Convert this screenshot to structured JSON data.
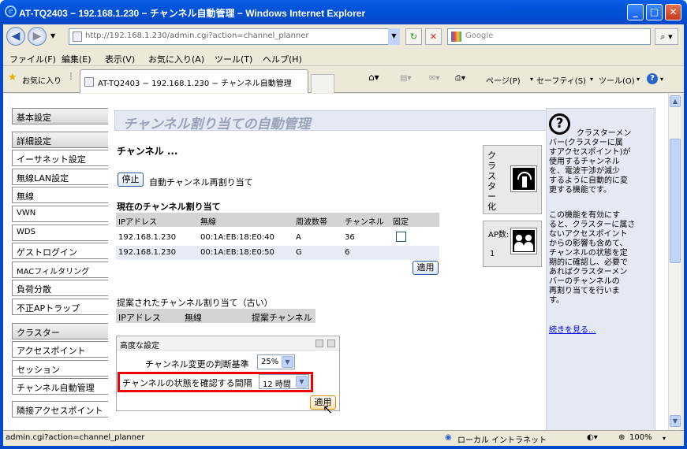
{
  "window": {
    "title": "AT-TQ2403 − 192.168.1.230 − チャンネル自動管理 − Windows Internet Explorer"
  },
  "addressbar": {
    "url": "http://192.168.1.230/admin.cgi?action=channel_planner",
    "search_placeholder": "Google"
  },
  "menu": [
    "ファイル(F)",
    "編集(E)",
    "表示(V)",
    "お気に入り(A)",
    "ツール(T)",
    "ヘルプ(H)"
  ],
  "tabbar": {
    "favorites": "お気に入り",
    "tab_title": "AT-TQ2403 − 192.168.1.230 − チャンネル自動管理",
    "page": "ページ(P)",
    "safety": "セーフティ(S)",
    "tools": "ツール(O)"
  },
  "sidebar": [
    {
      "label": "基本設定"
    },
    {
      "label": "詳細設定"
    },
    {
      "label": "イーサネット設定"
    },
    {
      "label": "無線LAN設定"
    },
    {
      "label": "無線"
    },
    {
      "label": "VWN"
    },
    {
      "label": "WDS"
    },
    {
      "label": "ゲストログイン"
    },
    {
      "label": "MACフィルタリング"
    },
    {
      "label": "負荷分散"
    },
    {
      "label": "不正APトラップ"
    },
    {
      "label": "クラスター"
    },
    {
      "label": "アクセスポイント"
    },
    {
      "label": "セッション"
    },
    {
      "label": "チャンネル自動管理"
    },
    {
      "label": "隣接アクセスポイント"
    }
  ],
  "main": {
    "page_title": "チャンネル割り当ての自動管理",
    "section_title": "チャンネル ...",
    "stop_button": "停止",
    "auto_label": "自動チャンネル再割り当て",
    "current_title": "現在のチャンネル割り当て",
    "current_headers": [
      "IPアドレス",
      "無線",
      "周波数帯",
      "チャンネル",
      "固定"
    ],
    "current_rows": [
      {
        "ip": "192.168.1.230",
        "radio": "00:1A:EB:18:E0:40",
        "band": "A",
        "channel": "36"
      },
      {
        "ip": "192.168.1.230",
        "radio": "00:1A:EB:18:E0:50",
        "band": "G",
        "channel": "6"
      }
    ],
    "apply_label": "適用",
    "proposed_title": "提案されたチャンネル割り当て（古い）",
    "proposed_headers": [
      "IPアドレス",
      "無線",
      "提案チャンネル"
    ],
    "advanced": {
      "title": "高度な設定",
      "criterion_label": "チャンネル変更の判断基準",
      "criterion_value": "25%",
      "interval_label": "チャンネルの状態を確認する間隔",
      "interval_value": "12 時間",
      "apply_label": "適用"
    }
  },
  "cluster_box": {
    "label": "クラスター化",
    "ap_label": "AP数:",
    "ap_count": "1"
  },
  "help": {
    "lines": [
      "クラスターメン",
      "バー(クラスターに属",
      "すアクセスポイント)が",
      "使用するチャンネル",
      "を、電波干渉が減少",
      "するように自動的に変",
      "更する機能です。",
      "",
      "この機能を有効にす",
      "ると、クラスターに属さ",
      "ないアクセスポイント",
      "からの影響も含めて、",
      "チャンネルの状態を定",
      "期的に確認し、必要で",
      "あればクラスターメン",
      "バーのチャンネルの",
      "再割り当てを行いま",
      "す。"
    ],
    "more_link": "続きを見る..."
  },
  "statusbar": {
    "url": "admin.cgi?action=channel_planner",
    "zone": "ローカル イントラネット",
    "zoom": "100%"
  }
}
